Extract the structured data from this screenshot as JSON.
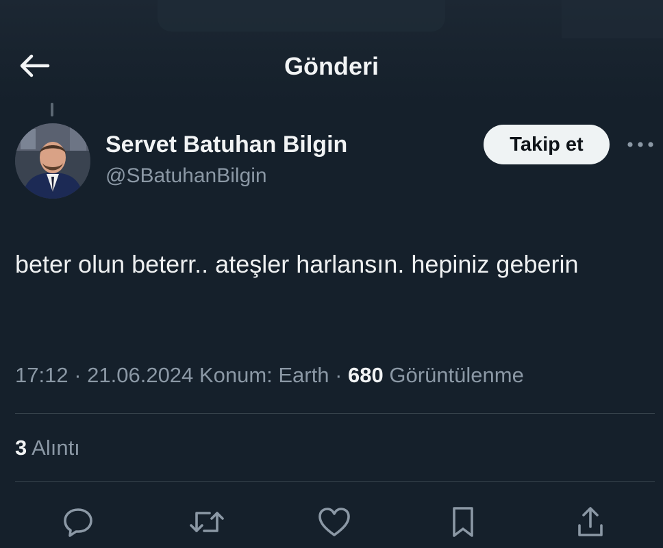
{
  "header": {
    "title": "Gönderi"
  },
  "author": {
    "name": "Servet Batuhan Bilgin",
    "handle": "@SBatuhanBilgin",
    "follow_label": "Takip et"
  },
  "tweet": {
    "text": "beter olun beterr.. ateşler harlansın. hepiniz geberin",
    "time": "17:12",
    "date": "21.06.2024",
    "location": "Konum: Earth",
    "views_count": "680",
    "views_label": "Görüntülenme",
    "quote_count": "3",
    "quote_label": "Alıntı"
  },
  "actions": [
    "reply-icon",
    "retweet-icon",
    "like-icon",
    "bookmark-icon",
    "share-icon"
  ],
  "colors": {
    "background": "#15202b",
    "text": "#e7e9ea",
    "secondary": "#8b98a5",
    "follow_bg": "#eff3f4",
    "divider": "#38444d"
  }
}
